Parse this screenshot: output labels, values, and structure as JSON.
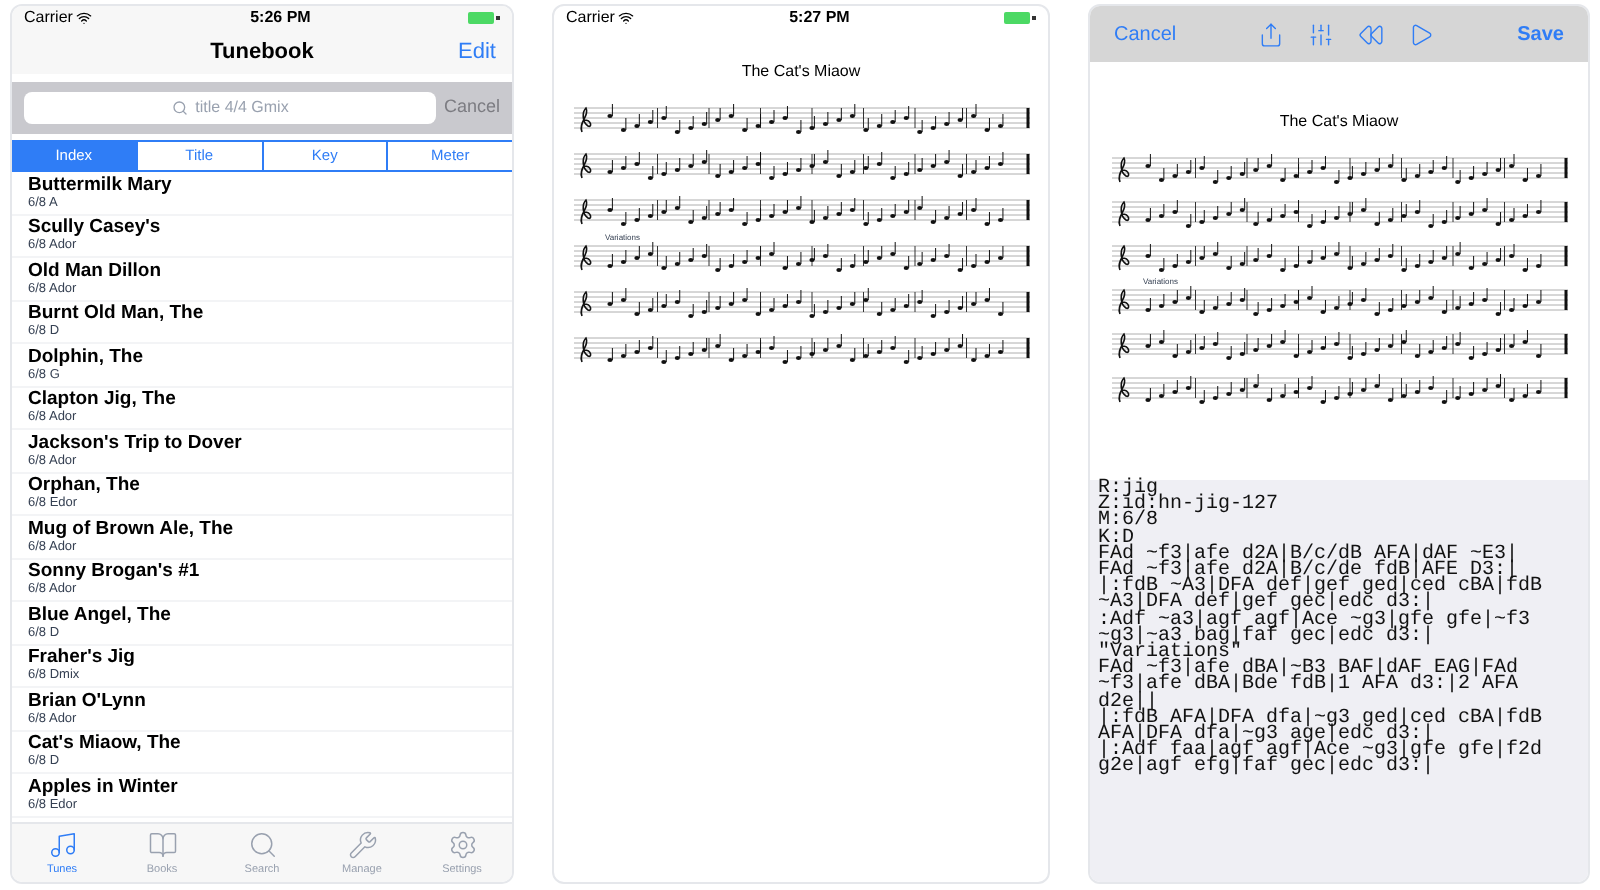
{
  "list_screen": {
    "status_bar": {
      "carrier": "Carrier",
      "time": "5:26 PM"
    },
    "nav": {
      "title": "Tunebook",
      "edit": "Edit"
    },
    "search": {
      "placeholder": "title 4/4 Gmix",
      "cancel": "Cancel"
    },
    "segments": [
      {
        "label": "Index",
        "selected": true
      },
      {
        "label": "Title",
        "selected": false
      },
      {
        "label": "Key",
        "selected": false
      },
      {
        "label": "Meter",
        "selected": false
      }
    ],
    "tunes": [
      {
        "title": "Buttermilk Mary",
        "meta": "6/8 A"
      },
      {
        "title": "Scully Casey's",
        "meta": "6/8 Ador"
      },
      {
        "title": "Old Man Dillon",
        "meta": "6/8 Ador"
      },
      {
        "title": "Burnt Old Man, The",
        "meta": "6/8 D"
      },
      {
        "title": "Dolphin, The",
        "meta": "6/8 G"
      },
      {
        "title": "Clapton Jig, The",
        "meta": "6/8 Ador"
      },
      {
        "title": "Jackson's Trip to Dover",
        "meta": "6/8 Ador"
      },
      {
        "title": "Orphan, The",
        "meta": "6/8 Edor"
      },
      {
        "title": "Mug of Brown Ale, The",
        "meta": "6/8 Ador"
      },
      {
        "title": "Sonny Brogan's #1",
        "meta": "6/8 Ador"
      },
      {
        "title": "Blue Angel, The",
        "meta": "6/8 D"
      },
      {
        "title": "Fraher's Jig",
        "meta": "6/8 Dmix"
      },
      {
        "title": "Brian O'Lynn",
        "meta": "6/8 Ador"
      },
      {
        "title": "Cat's Miaow, The",
        "meta": "6/8 D"
      },
      {
        "title": "Apples in Winter",
        "meta": "6/8 Edor"
      }
    ],
    "tab_bar": [
      {
        "kind": "tunes",
        "label": "Tunes",
        "selected": true
      },
      {
        "kind": "books",
        "label": "Books",
        "selected": false
      },
      {
        "kind": "search",
        "label": "Search",
        "selected": false
      },
      {
        "kind": "manage",
        "label": "Manage",
        "selected": false
      },
      {
        "kind": "settings",
        "label": "Settings",
        "selected": false
      }
    ]
  },
  "score_screen": {
    "status_bar": {
      "carrier": "Carrier",
      "time": "5:27 PM"
    },
    "title": "The Cat's Miaow",
    "variations_label": "Variations"
  },
  "editor_screen": {
    "toolbar": {
      "cancel": "Cancel",
      "save": "Save",
      "tools": [
        {
          "kind": "share"
        },
        {
          "kind": "sliders"
        },
        {
          "kind": "rewind"
        },
        {
          "kind": "play"
        }
      ]
    },
    "title": "The Cat's Miaow",
    "variations_label": "Variations",
    "abc_text": "R:jig\nZ:id:hn-jig-127\nM:6/8\nK:D\nFAd ~f3|afe d2A|B/c/dB AFA|dAF ~E3|\nFAd ~f3|afe d2A|B/c/de fdB|AFE D3:|\n|:fdB ~A3|DFA def|gef ged|ced cBA|fdB\n~A3|DFA def|gef gec|edc d3:|\n:Adf ~a3|agf agf|Ace ~g3|gfe gfe|~f3\n~g3|~a3 bag|faf gec|edc d3:|\n\"Variations\"\nFAd ~f3|afe dBA|~B3 BAF|dAF EAG|FAd\n~f3|afe dBA|Bde fdB|1 AFA d3:|2 AFA\nd2e||\n|:fdB AFA|DFA dfa|~g3 ged|ced cBA|fdB\nAFA|DFA dfa|~g3 age|edc d3:|\n|:Adf faa|agf agf|Ace ~g3|gfe gfe|f2d\ng2e|agf efg|faf gec|edc d3:|"
  }
}
